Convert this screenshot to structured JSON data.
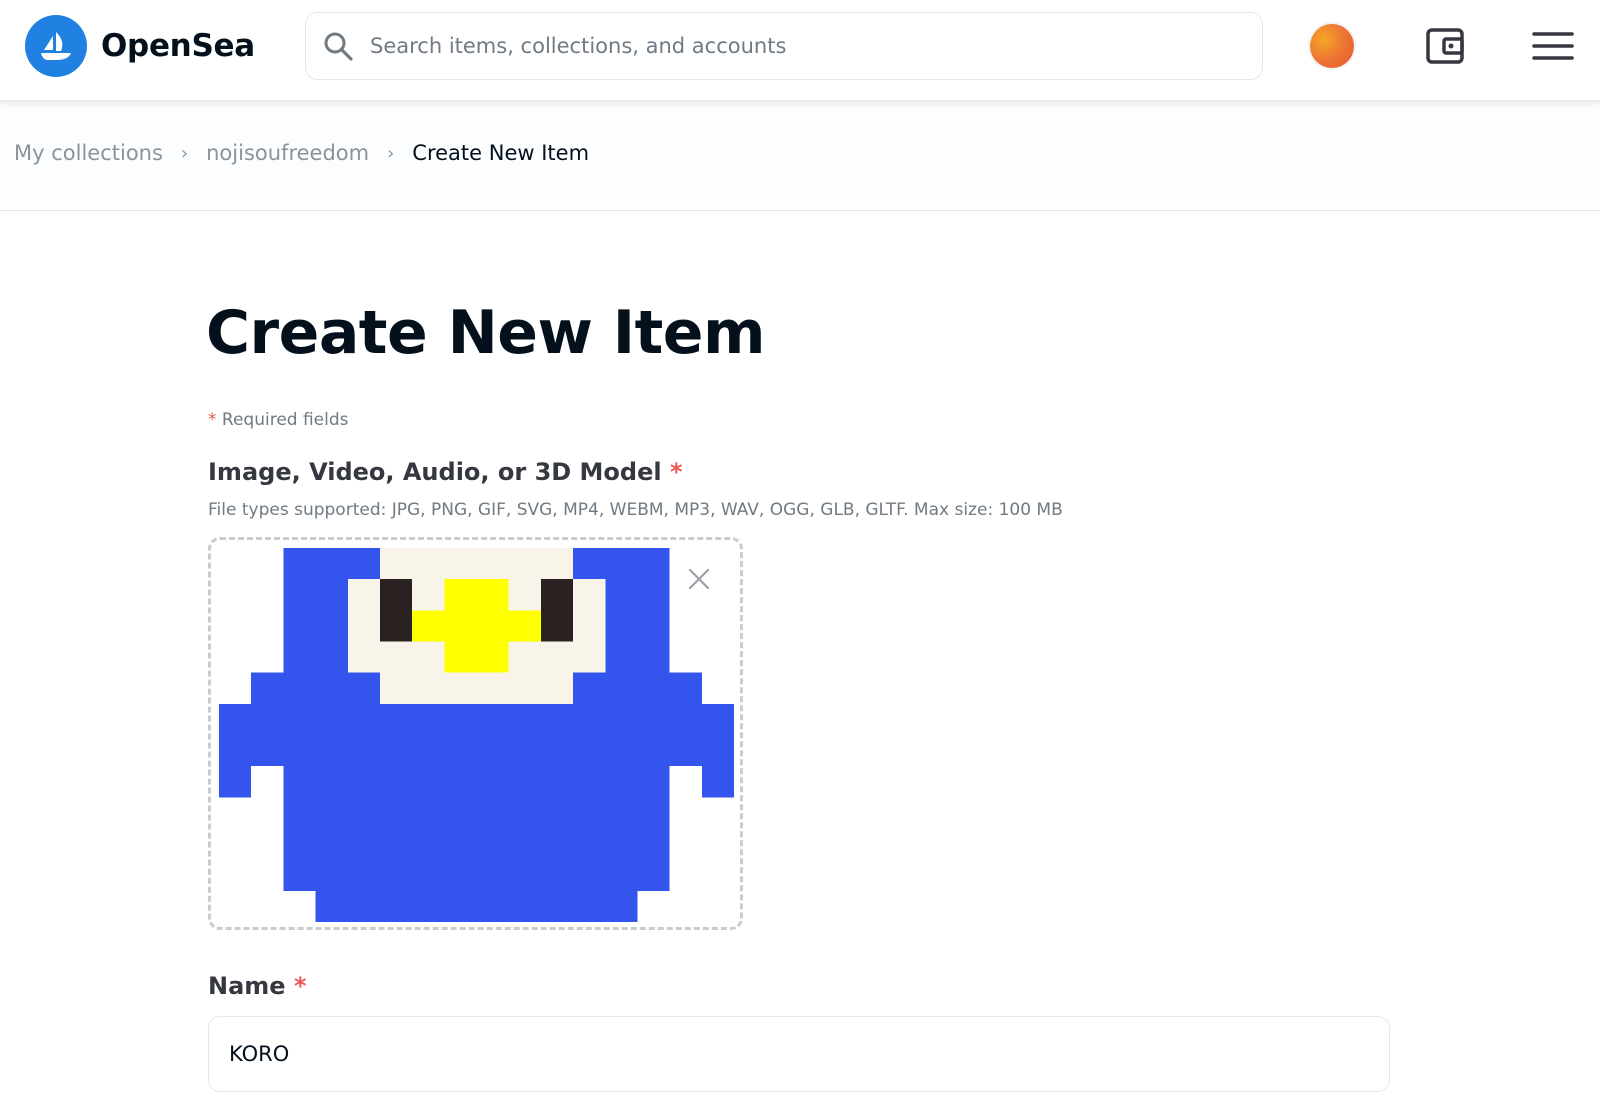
{
  "header": {
    "brand": "OpenSea",
    "search_placeholder": "Search items, collections, and accounts",
    "icons": [
      "opensea-logo-icon",
      "search-icon",
      "avatar",
      "wallet-icon",
      "menu-icon"
    ],
    "brand_color": "#2081e2"
  },
  "breadcrumb": {
    "items": [
      "My collections",
      "nojisoufreedom"
    ],
    "separator": "›",
    "current": "Create New Item"
  },
  "main": {
    "title": "Create New Item",
    "required_asterisk": "*",
    "required_note": "Required fields",
    "media": {
      "label": "Image, Video, Audio, or 3D Model",
      "asterisk": "*",
      "description": "File types supported: JPG, PNG, GIF, SVG, MP4, WEBM, MP3, WAV, OGG, GLB, GLTF. Max size: 100 MB"
    },
    "name": {
      "label": "Name",
      "asterisk": "*",
      "value": "KORO"
    }
  },
  "colors": {
    "pixel_blue": "#3355ee",
    "pixel_cream": "#f8f4ea",
    "pixel_yellow": "#ffff00",
    "pixel_eye": "#2a2220",
    "required_red": "#eb5757"
  }
}
